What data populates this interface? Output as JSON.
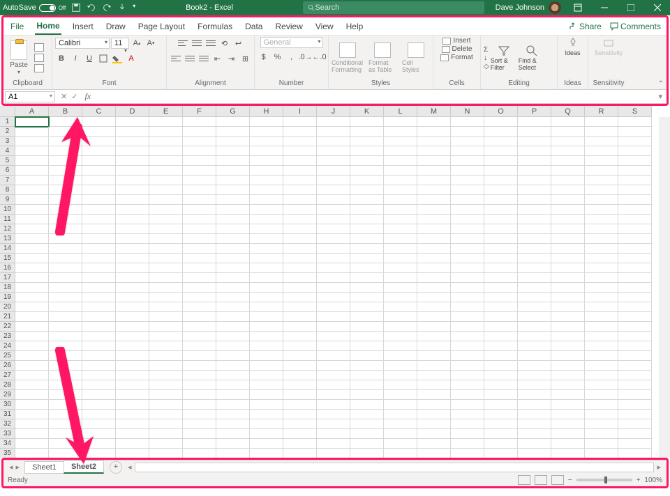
{
  "titlebar": {
    "autosave": "AutoSave",
    "autosave_state": "Off",
    "doc_title": "Book2 - Excel",
    "search_placeholder": "Search",
    "user_name": "Dave Johnson"
  },
  "tabs": {
    "file": "File",
    "home": "Home",
    "insert": "Insert",
    "draw": "Draw",
    "page_layout": "Page Layout",
    "formulas": "Formulas",
    "data": "Data",
    "review": "Review",
    "view": "View",
    "help": "Help",
    "share": "Share",
    "comments": "Comments"
  },
  "ribbon": {
    "clipboard": {
      "label": "Clipboard",
      "paste": "Paste"
    },
    "font": {
      "label": "Font",
      "name": "Calibri",
      "size": "11",
      "bold": "B",
      "italic": "I",
      "underline": "U"
    },
    "alignment": {
      "label": "Alignment"
    },
    "number": {
      "label": "Number",
      "format": "General"
    },
    "styles": {
      "label": "Styles",
      "conditional": "Conditional Formatting",
      "table": "Format as Table",
      "cell": "Cell Styles"
    },
    "cells": {
      "label": "Cells",
      "insert": "Insert",
      "delete": "Delete",
      "format": "Format"
    },
    "editing": {
      "label": "Editing",
      "sort": "Sort & Filter",
      "find": "Find & Select"
    },
    "ideas": {
      "label": "Ideas",
      "btn": "Ideas"
    },
    "sensitivity": {
      "label": "Sensitivity",
      "btn": "Sensitivity"
    }
  },
  "namebox": {
    "value": "A1",
    "fx": "fx"
  },
  "columns": [
    "A",
    "B",
    "C",
    "D",
    "E",
    "F",
    "G",
    "H",
    "I",
    "J",
    "K",
    "L",
    "M",
    "N",
    "O",
    "P",
    "Q",
    "R",
    "S"
  ],
  "rows": [
    "1",
    "2",
    "3",
    "4",
    "5",
    "6",
    "7",
    "8",
    "9",
    "10",
    "11",
    "12",
    "13",
    "14",
    "15",
    "16",
    "17",
    "18",
    "19",
    "20",
    "21",
    "22",
    "23",
    "24",
    "25",
    "26",
    "27",
    "28",
    "29",
    "30",
    "31",
    "32",
    "33",
    "34",
    "35"
  ],
  "sheets": {
    "sheet1": "Sheet1",
    "sheet2": "Sheet2"
  },
  "status": {
    "ready": "Ready",
    "zoom": "100%"
  }
}
